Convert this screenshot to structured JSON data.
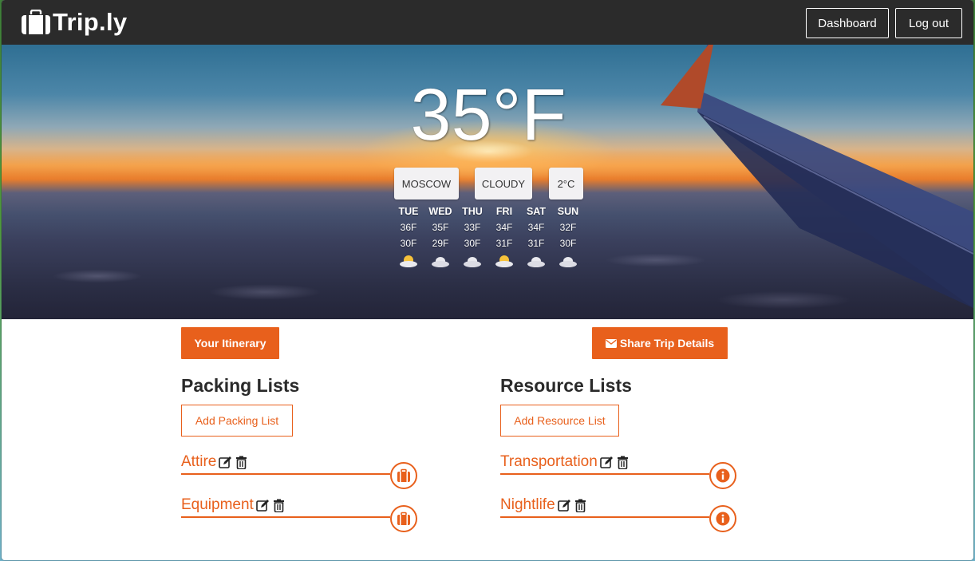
{
  "app": {
    "brand": "Trip.ly"
  },
  "nav": {
    "dashboard_label": "Dashboard",
    "logout_label": "Log out"
  },
  "weather": {
    "temperature": "35°F",
    "city": "MOSCOW",
    "condition": "CLOUDY",
    "celsius": "2°C",
    "forecast": [
      {
        "day": "TUE",
        "high": "36F",
        "low": "30F",
        "icon": "partly-sunny-icon"
      },
      {
        "day": "WED",
        "high": "35F",
        "low": "29F",
        "icon": "cloud-icon"
      },
      {
        "day": "THU",
        "high": "33F",
        "low": "30F",
        "icon": "cloud-icon"
      },
      {
        "day": "FRI",
        "high": "34F",
        "low": "31F",
        "icon": "partly-sunny-icon"
      },
      {
        "day": "SAT",
        "high": "34F",
        "low": "31F",
        "icon": "cloud-icon"
      },
      {
        "day": "SUN",
        "high": "32F",
        "low": "30F",
        "icon": "cloud-icon"
      }
    ]
  },
  "actions": {
    "itinerary_label": "Your Itinerary",
    "share_label": "Share Trip Details"
  },
  "packing": {
    "title": "Packing Lists",
    "add_label": "Add Packing List",
    "items": [
      {
        "name": "Attire",
        "action_icon": "suitcase-icon"
      },
      {
        "name": "Equipment",
        "action_icon": "suitcase-icon"
      }
    ]
  },
  "resources": {
    "title": "Resource Lists",
    "add_label": "Add Resource List",
    "items": [
      {
        "name": "Transportation",
        "action_icon": "info-icon"
      },
      {
        "name": "Nightlife",
        "action_icon": "info-icon"
      }
    ]
  },
  "colors": {
    "accent": "#e8601c",
    "navbar": "#2b2b2b",
    "heading": "#2a2a2a"
  }
}
